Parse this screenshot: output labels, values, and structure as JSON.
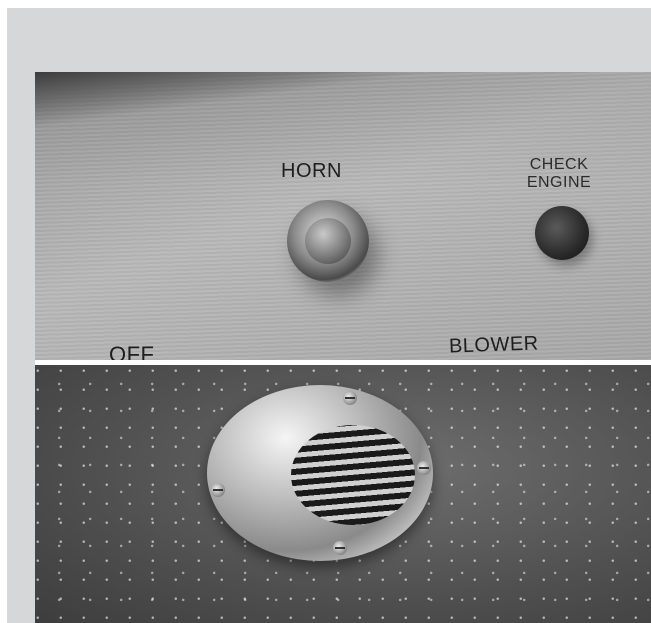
{
  "labels": {
    "horn": "HORN",
    "check_line1": "CHECK",
    "check_line2": "ENGINE",
    "off": "OFF",
    "blower": "BLOWER"
  },
  "colors": {
    "frame_background": "#d6d7d8",
    "label_text": "#1e1e1e"
  }
}
